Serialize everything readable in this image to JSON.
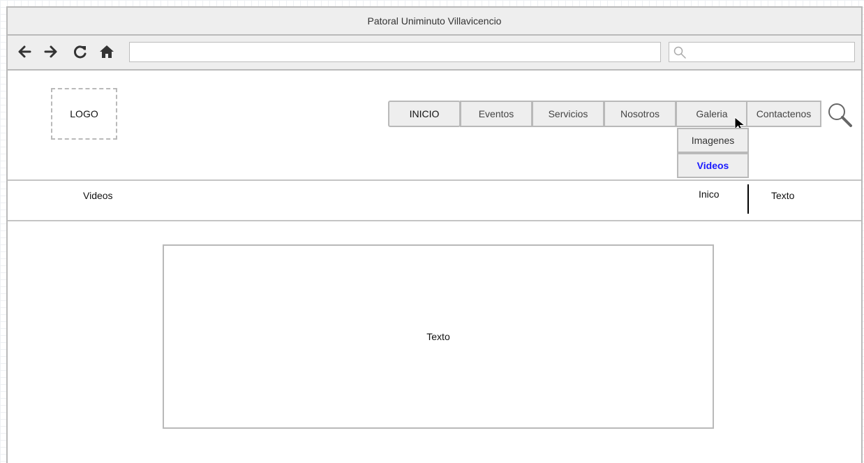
{
  "window": {
    "title": "Patoral Uniminuto Villavicencio"
  },
  "toolbar": {
    "back_icon": "arrow-left-icon",
    "forward_icon": "arrow-right-icon",
    "reload_icon": "reload-icon",
    "home_icon": "home-icon",
    "url_value": "",
    "search_value": "",
    "search_icon": "search-icon"
  },
  "header": {
    "logo_text": "LOGO",
    "menu": [
      "INICIO",
      "Eventos",
      "Servicios",
      "Nosotros",
      "Galeria",
      "Contactenos"
    ],
    "submenu": [
      "Imagenes",
      "Videos"
    ],
    "active_submenu": "Videos",
    "active_color": "#1a1aff",
    "search_icon": "magnifier-icon",
    "cursor_icon": "mouse-pointer-icon"
  },
  "breadcrumb": {
    "title": "Videos",
    "link": "Inico",
    "text": "Texto"
  },
  "main": {
    "box_text": "Texto"
  }
}
